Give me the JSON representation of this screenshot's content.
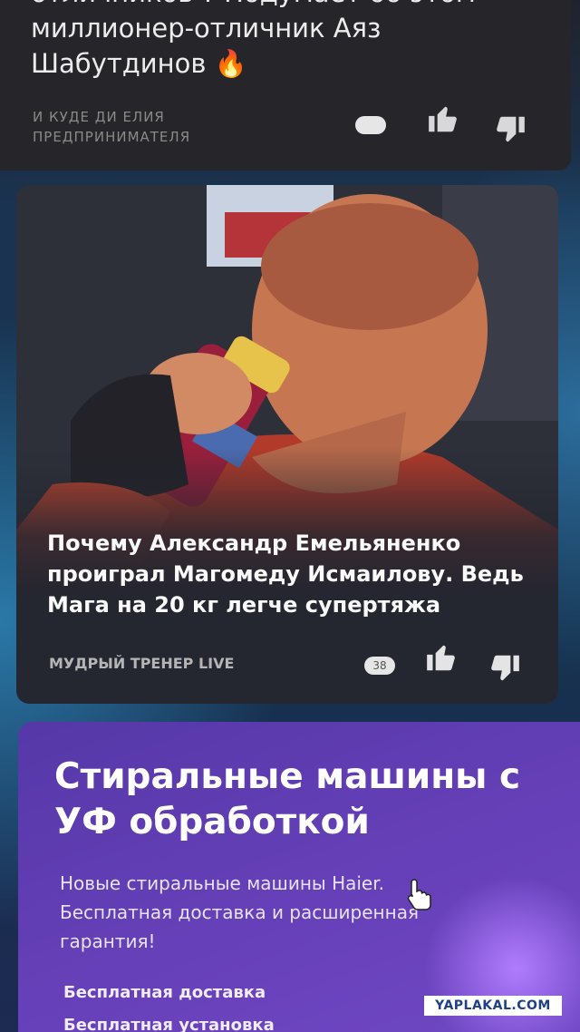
{
  "top_card": {
    "title_cut": "отличников ? Подумает об этом",
    "title_line2": "миллионер-отличник Аяз",
    "title_line3": "Шабутдинов",
    "flame_icon": "🔥",
    "source": "И КУДЕ ДИ ЕЛИЯ ПРЕДПРИНИМАТЕЛЯ",
    "comments": "",
    "like_icon": "thumbs-up-icon",
    "dislike_icon": "thumbs-down-icon"
  },
  "main_card": {
    "headline": "Почему Александр Емельяненко проиграл Магомеду Исмаилову. Ведь Мага на 20 кг легче супертяжа",
    "source": "МУДРЫЙ ТРЕНЕР LIVE",
    "comments": "38"
  },
  "ad": {
    "title": "Стиральные машины с УФ обработкой",
    "text": "Новые стиральные машины Haier. Бесплатная доставка и расширенная гарантия!",
    "features": [
      "Бесплатная доставка",
      "Бесплатная установка"
    ]
  },
  "watermark": "YAPLAKAL.COM",
  "colors": {
    "accent_like": "#e4e4e4",
    "ad_bg": "#6240b4",
    "card_bg": "#242630"
  }
}
